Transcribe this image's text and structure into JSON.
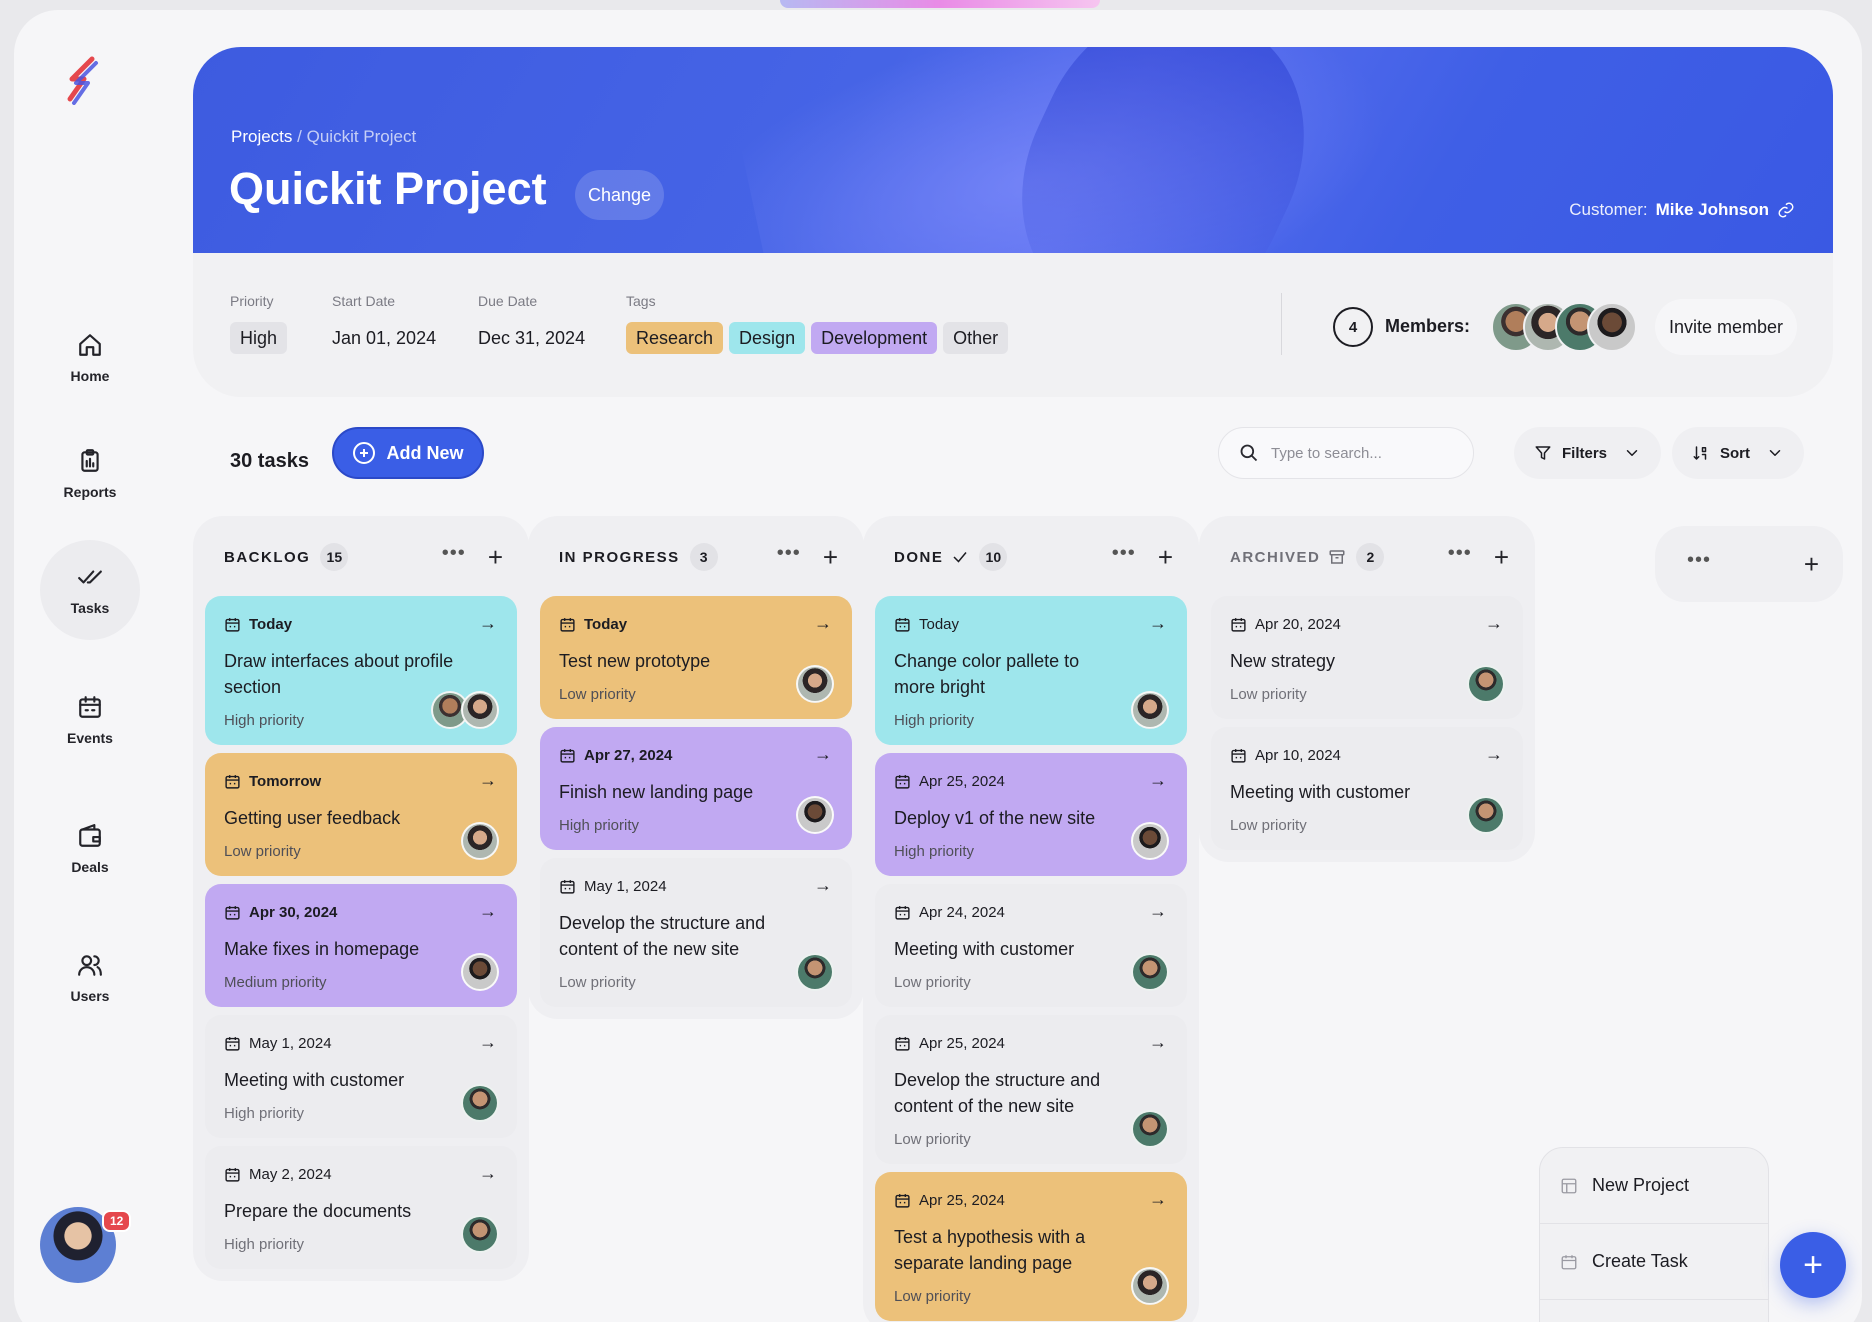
{
  "breadcrumb": {
    "root": "Projects",
    "separator": "/",
    "current": "Quickit Project"
  },
  "project": {
    "title": "Quickit Project",
    "change_label": "Change",
    "customer_label": "Customer:",
    "customer_name": "Mike Johnson"
  },
  "info": {
    "priority_label": "Priority",
    "priority_value": "High",
    "start_label": "Start Date",
    "start_value": "Jan 01, 2024",
    "due_label": "Due Date",
    "due_value": "Dec 31, 2024",
    "tags_label": "Tags",
    "tags": [
      {
        "label": "Research",
        "color": "#ecc17a"
      },
      {
        "label": "Design",
        "color": "#9ee6ec"
      },
      {
        "label": "Development",
        "color": "#c1a9f2"
      },
      {
        "label": "Other",
        "color": "#e3e3e7"
      }
    ],
    "members_count": "4",
    "members_label": "Members:",
    "invite_label": "Invite member"
  },
  "sidebar": {
    "items": [
      {
        "label": "Home",
        "icon": "home-icon"
      },
      {
        "label": "Reports",
        "icon": "clipboard-icon"
      },
      {
        "label": "Tasks",
        "icon": "double-check-icon",
        "active": true
      },
      {
        "label": "Events",
        "icon": "calendar-icon"
      },
      {
        "label": "Deals",
        "icon": "wallet-icon"
      },
      {
        "label": "Users",
        "icon": "users-icon"
      }
    ],
    "notifications": "12"
  },
  "toolbar": {
    "task_count": "30 tasks",
    "add_new_label": "Add New",
    "search_placeholder": "Type to search...",
    "filters_label": "Filters",
    "sort_label": "Sort"
  },
  "columns": [
    {
      "title": "BACKLOG",
      "count": "15",
      "cards": [
        {
          "date": "Today",
          "title": "Draw interfaces about profile section",
          "priority": "High priority",
          "color": "cyan"
        },
        {
          "date": "Tomorrow",
          "title": "Getting user feedback",
          "priority": "Low priority",
          "color": "orange"
        },
        {
          "date": "Apr 30, 2024",
          "title": "Make fixes in homepage",
          "priority": "Medium priority",
          "color": "purple"
        },
        {
          "date": "May 1, 2024",
          "title": "Meeting with customer",
          "priority": "High priority",
          "color": "gray"
        },
        {
          "date": "May 2, 2024",
          "title": "Prepare the documents",
          "priority": "High priority",
          "color": "gray"
        }
      ]
    },
    {
      "title": "IN PROGRESS",
      "count": "3",
      "cards": [
        {
          "date": "Today",
          "title": "Test new prototype",
          "priority": "Low priority",
          "color": "orange"
        },
        {
          "date": "Apr 27, 2024",
          "title": "Finish new landing page",
          "priority": "High priority",
          "color": "purple"
        },
        {
          "date": "May 1, 2024",
          "title": "Develop the structure and content of the new site",
          "priority": "Low priority",
          "color": "gray"
        }
      ]
    },
    {
      "title": "DONE",
      "count": "10",
      "cards": [
        {
          "date": "Today",
          "title": "Change color pallete to more bright",
          "priority": "High priority",
          "color": "cyan"
        },
        {
          "date": "Apr 25, 2024",
          "title": "Deploy v1 of the new site",
          "priority": "High priority",
          "color": "purple"
        },
        {
          "date": "Apr 24, 2024",
          "title": "Meeting with customer",
          "priority": "Low priority",
          "color": "gray"
        },
        {
          "date": "Apr 25, 2024",
          "title": "Develop the structure and content of the new site",
          "priority": "Low priority",
          "color": "gray"
        },
        {
          "date": "Apr 25, 2024",
          "title": "Test a hypothesis with a separate landing page",
          "priority": "Low priority",
          "color": "orange"
        }
      ]
    },
    {
      "title": "ARCHIVED",
      "count": "2",
      "cards": [
        {
          "date": "Apr 20, 2024",
          "title": "New strategy",
          "priority": "Low priority",
          "color": "gray"
        },
        {
          "date": "Apr 10, 2024",
          "title": "Meeting with customer",
          "priority": "Low priority",
          "color": "gray"
        }
      ]
    }
  ],
  "popup": {
    "new_project": "New Project",
    "create_task": "Create Task"
  }
}
